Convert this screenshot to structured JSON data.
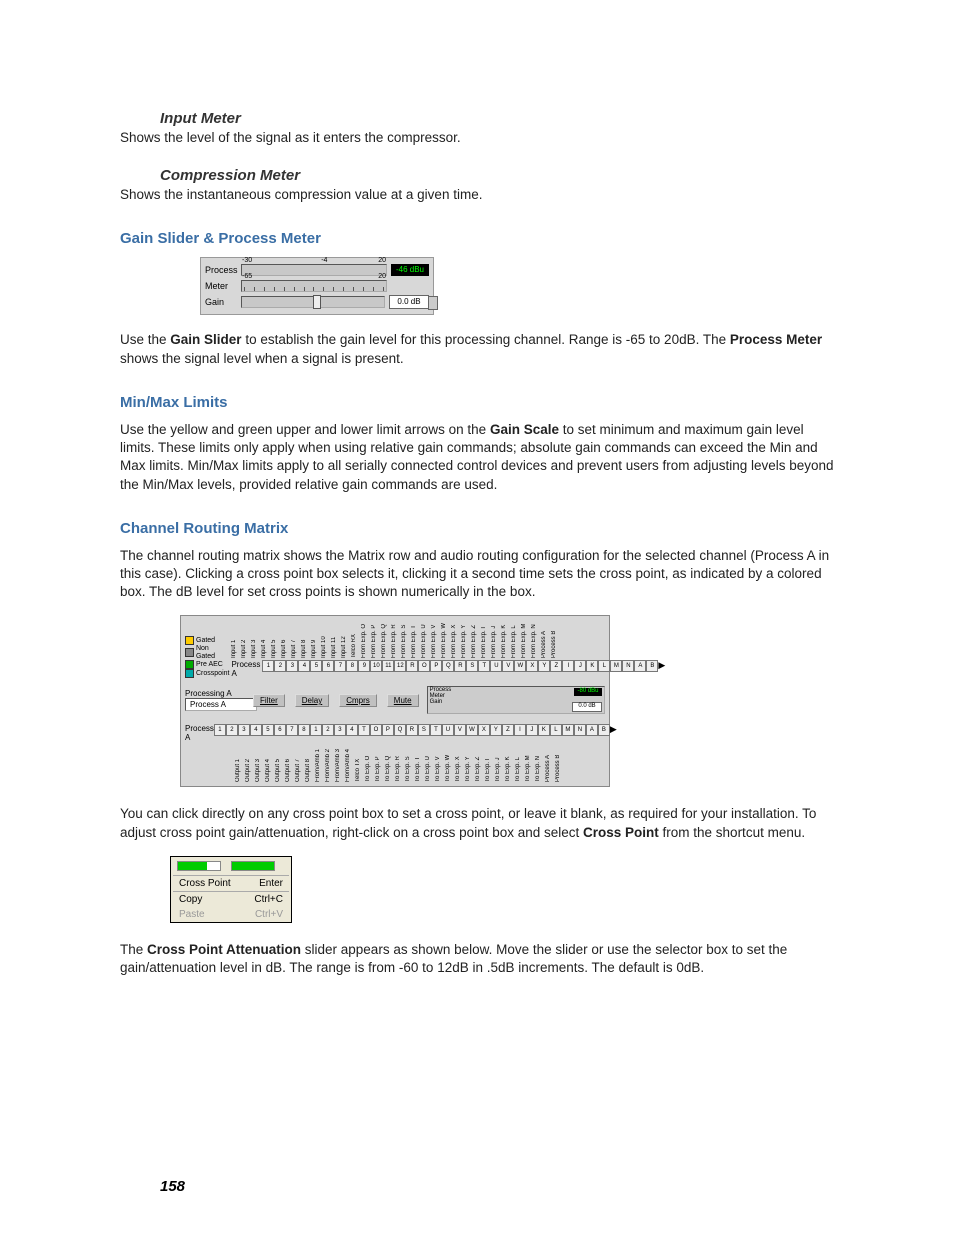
{
  "page_number": "158",
  "sec_input_meter": {
    "title": "Input Meter",
    "body": "Shows the level of the signal as it enters the compressor."
  },
  "sec_compression_meter": {
    "title": "Compression Meter",
    "body": "Shows the instantaneous compression value at a given time."
  },
  "sec_gain": {
    "title": "Gain Slider & Process Meter",
    "body_pre": "Use the ",
    "k_gain_slider": "Gain Slider",
    "body_mid": " to establish the gain level for this processing channel. Range is -65 to 20dB. The ",
    "k_process_meter": "Process Meter",
    "body_post": " shows the signal level when a signal is present.",
    "fig": {
      "row1_label": "Process",
      "row2_label": "Meter",
      "row3_label": "Gain",
      "tick_neg30": "-30",
      "tick_neg4": "-4",
      "tick_20": "20",
      "tick_neg65": "-65",
      "readout": "-46 dBu",
      "spin": "0.0 dB"
    }
  },
  "sec_minmax": {
    "title": "Min/Max Limits",
    "body_pre": "Use the yellow and green upper and lower limit arrows on the ",
    "k_gain_scale": "Gain Scale",
    "body_post": " to set minimum and maximum gain level limits. These limits only apply when using relative gain commands; absolute gain commands can exceed the Min and Max limits. Min/Max limits apply to all serially connected control devices and prevent users from adjusting levels beyond the Min/Max levels, provided relative gain commands are used."
  },
  "sec_routing": {
    "title": "Channel Routing Matrix",
    "body": "The channel routing matrix shows the Matrix row and audio routing configuration for the selected channel (Process A in this case). Clicking a cross point box selects it, clicking it a second time sets the cross point, as indicated by a colored box. The dB level for set cross points is shown numerically in the box.",
    "fig": {
      "legend": {
        "gated": "Gated",
        "nongated": "Non Gated",
        "preaec": "Pre AEC",
        "crosspoint": "Crosspoint"
      },
      "row_label": "Process A",
      "proc_label": "Processing A",
      "proc_box": "Process A",
      "btn_filter": "Filter",
      "btn_delay": "Delay",
      "btn_comprs": "Cmprs",
      "btn_mute": "Mute",
      "mini": {
        "l1": "Process",
        "l2": "Meter",
        "l3": "Gain",
        "ro": "-80 dBu",
        "sb": "0.0 dB",
        "t_n30": "-30",
        "t_20": "20",
        "t_n65": "-65"
      },
      "top_cols": [
        "Input 1",
        "Input 2",
        "Input 3",
        "Input 4",
        "Input 5",
        "Input 6",
        "Input 7",
        "Input 8",
        "Input 9",
        "Input 10",
        "Input 11",
        "Input 12",
        "Telco RX",
        "From Exp. O",
        "From Exp. P",
        "From Exp. Q",
        "From Exp. R",
        "From Exp. S",
        "From Exp. T",
        "From Exp. U",
        "From Exp. V",
        "From Exp. W",
        "From Exp. X",
        "From Exp. Y",
        "From Exp. Z",
        "From Exp. I",
        "From Exp. J",
        "From Exp. K",
        "From Exp. L",
        "From Exp. M",
        "From Exp. N",
        "Process A",
        "Process B"
      ],
      "top_cells": [
        "1",
        "2",
        "3",
        "4",
        "5",
        "6",
        "7",
        "8",
        "9",
        "10",
        "11",
        "12",
        "R",
        "O",
        "P",
        "Q",
        "R",
        "S",
        "T",
        "U",
        "V",
        "W",
        "X",
        "Y",
        "Z",
        "I",
        "J",
        "K",
        "L",
        "M",
        "N",
        "A",
        "B"
      ],
      "bot_cells": [
        "1",
        "2",
        "3",
        "4",
        "5",
        "6",
        "7",
        "8",
        "1",
        "2",
        "3",
        "4",
        "T",
        "O",
        "P",
        "Q",
        "R",
        "S",
        "T",
        "U",
        "V",
        "W",
        "X",
        "Y",
        "Z",
        "I",
        "J",
        "K",
        "L",
        "M",
        "N",
        "A",
        "B"
      ],
      "bot_cols": [
        "Output 1",
        "Output 2",
        "Output 3",
        "Output 4",
        "Output 5",
        "Output 6",
        "Output 7",
        "Output 8",
        "From/Amb 1",
        "From/Amb 2",
        "From/Amb 3",
        "From/Amb 4",
        "Telco TX",
        "To Exp. O",
        "To Exp. P",
        "To Exp. Q",
        "To Exp. R",
        "To Exp. S",
        "To Exp. T",
        "To Exp. U",
        "To Exp. V",
        "To Exp. W",
        "To Exp. X",
        "To Exp. Y",
        "To Exp. Z",
        "To Exp. I",
        "To Exp. J",
        "To Exp. K",
        "To Exp. L",
        "To Exp. M",
        "To Exp. N",
        "Process A",
        "Process B"
      ]
    },
    "after_pre": "You can click directly on any cross point box to set a cross point, or leave it blank, as required for your installation. To adjust cross point gain/attenuation, right-click on a cross point box and select ",
    "after_k": "Cross Point",
    "after_post": " from the shortcut menu."
  },
  "context_menu": {
    "item_crosspoint": "Cross Point",
    "kb_crosspoint": "Enter",
    "item_copy": "Copy",
    "kb_copy": "Ctrl+C",
    "item_paste": "Paste",
    "kb_paste": "Ctrl+V"
  },
  "sec_slider": {
    "body_pre": "The ",
    "k_slider": "Cross Point Attenuation",
    "body_post": " slider appears as shown below. Move the slider or use the selector box to set the gain/attenuation level in dB. The range is from -60 to 12dB in .5dB increments. The default is 0dB."
  }
}
